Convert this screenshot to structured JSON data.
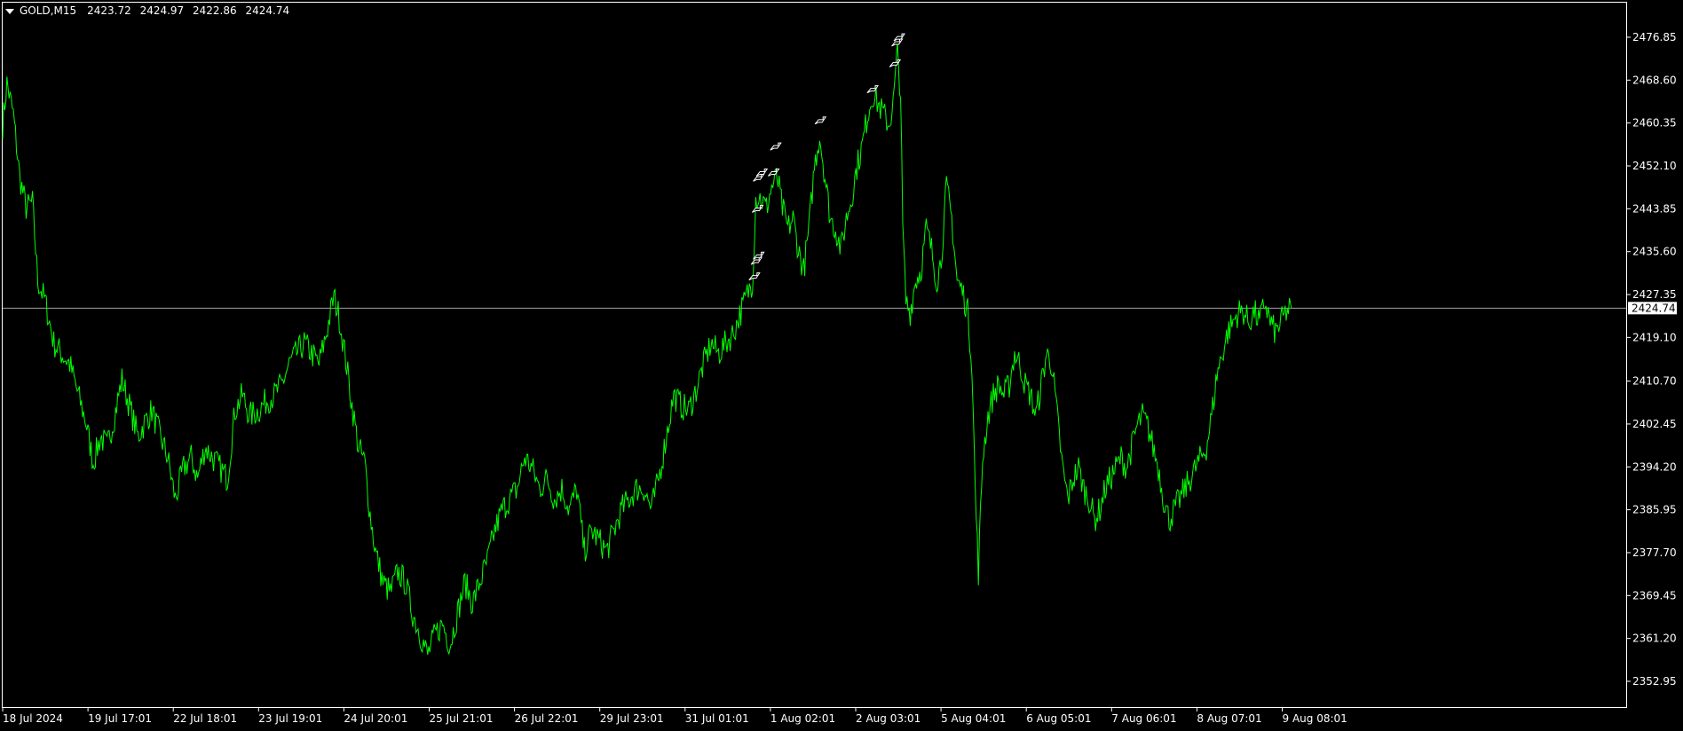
{
  "window": {
    "symbol_label": "GOLD,M15",
    "open": "2423.72",
    "high": "2424.97",
    "low": "2422.86",
    "close": "2424.74"
  },
  "colors": {
    "background": "#000000",
    "line": "#00FF00",
    "grid_frame": "#FFFFFF",
    "bid_line": "#A0A0A0",
    "arrow_marker": "#FFFFFF"
  },
  "chart_data": {
    "type": "line",
    "title": "",
    "xlabel": "",
    "ylabel": "",
    "grid": false,
    "ylim": [
      2348.0,
      2483.5
    ],
    "current_price": 2424.74,
    "current_price_label": "2424.74",
    "y_ticks": [
      "2476.85",
      "2468.60",
      "2460.35",
      "2452.10",
      "2443.85",
      "2435.60",
      "2427.35",
      "2419.10",
      "2410.70",
      "2402.45",
      "2394.20",
      "2385.95",
      "2377.70",
      "2369.45",
      "2361.20",
      "2352.95"
    ],
    "x_ticks": [
      "18 Jul 2024",
      "19 Jul 17:01",
      "22 Jul 18:01",
      "23 Jul 19:01",
      "24 Jul 20:01",
      "25 Jul 21:01",
      "26 Jul 22:01",
      "29 Jul 23:01",
      "31 Jul 01:01",
      "1 Aug 02:01",
      "2 Aug 03:01",
      "5 Aug 04:01",
      "6 Aug 05:01",
      "7 Aug 06:01",
      "8 Aug 07:01",
      "9 Aug 08:01"
    ],
    "series": [
      {
        "points": [
          [
            0,
            2460
          ],
          [
            4,
            2468
          ],
          [
            10,
            2462
          ],
          [
            16,
            2450
          ],
          [
            22,
            2444
          ],
          [
            28,
            2445
          ],
          [
            33,
            2430
          ],
          [
            40,
            2426
          ],
          [
            48,
            2418
          ],
          [
            55,
            2416
          ],
          [
            63,
            2414
          ],
          [
            71,
            2408
          ],
          [
            78,
            2403
          ],
          [
            85,
            2395
          ],
          [
            92,
            2400
          ],
          [
            98,
            2398
          ],
          [
            105,
            2404
          ],
          [
            112,
            2411
          ],
          [
            119,
            2406
          ],
          [
            127,
            2400
          ],
          [
            134,
            2403
          ],
          [
            140,
            2405
          ],
          [
            148,
            2400
          ],
          [
            155,
            2396
          ],
          [
            162,
            2388
          ],
          [
            170,
            2394
          ],
          [
            177,
            2396
          ],
          [
            183,
            2392
          ],
          [
            190,
            2398
          ],
          [
            197,
            2396
          ],
          [
            204,
            2394
          ],
          [
            211,
            2392
          ],
          [
            218,
            2405
          ],
          [
            225,
            2408
          ],
          [
            232,
            2404
          ],
          [
            240,
            2405
          ],
          [
            248,
            2407
          ],
          [
            255,
            2408
          ],
          [
            262,
            2410
          ],
          [
            269,
            2414
          ],
          [
            276,
            2416
          ],
          [
            283,
            2418
          ],
          [
            290,
            2416
          ],
          [
            297,
            2414
          ],
          [
            304,
            2420
          ],
          [
            311,
            2427
          ],
          [
            316,
            2423
          ],
          [
            322,
            2415
          ],
          [
            328,
            2406
          ],
          [
            334,
            2398
          ],
          [
            340,
            2395
          ],
          [
            345,
            2385
          ],
          [
            350,
            2378
          ],
          [
            357,
            2372
          ],
          [
            364,
            2370
          ],
          [
            371,
            2374
          ],
          [
            378,
            2372
          ],
          [
            385,
            2366
          ],
          [
            392,
            2362
          ],
          [
            399,
            2358
          ],
          [
            406,
            2362
          ],
          [
            413,
            2364
          ],
          [
            420,
            2360
          ],
          [
            427,
            2366
          ],
          [
            434,
            2372
          ],
          [
            441,
            2368
          ],
          [
            448,
            2372
          ],
          [
            455,
            2376
          ],
          [
            462,
            2382
          ],
          [
            469,
            2386
          ],
          [
            476,
            2388
          ],
          [
            483,
            2390
          ],
          [
            490,
            2396
          ],
          [
            497,
            2394
          ],
          [
            504,
            2390
          ],
          [
            511,
            2392
          ],
          [
            518,
            2388
          ],
          [
            525,
            2390
          ],
          [
            532,
            2386
          ],
          [
            539,
            2390
          ],
          [
            546,
            2378
          ],
          [
            553,
            2382
          ],
          [
            560,
            2380
          ],
          [
            567,
            2378
          ],
          [
            574,
            2382
          ],
          [
            581,
            2386
          ],
          [
            588,
            2388
          ],
          [
            595,
            2390
          ],
          [
            602,
            2390
          ],
          [
            609,
            2386
          ],
          [
            616,
            2392
          ],
          [
            623,
            2400
          ],
          [
            630,
            2408
          ],
          [
            637,
            2406
          ],
          [
            644,
            2405
          ],
          [
            651,
            2409
          ],
          [
            658,
            2414
          ],
          [
            665,
            2418
          ],
          [
            672,
            2416
          ],
          [
            679,
            2418
          ],
          [
            686,
            2420
          ],
          [
            693,
            2424
          ],
          [
            700,
            2428
          ],
          [
            704,
            2430
          ],
          [
            707,
            2446
          ],
          [
            711,
            2446
          ],
          [
            717,
            2444
          ],
          [
            722,
            2448
          ],
          [
            727,
            2450
          ],
          [
            732,
            2444
          ],
          [
            737,
            2440
          ],
          [
            742,
            2442
          ],
          [
            747,
            2436
          ],
          [
            752,
            2432
          ],
          [
            757,
            2440
          ],
          [
            762,
            2452
          ],
          [
            767,
            2458
          ],
          [
            772,
            2450
          ],
          [
            777,
            2442
          ],
          [
            782,
            2440
          ],
          [
            787,
            2436
          ],
          [
            792,
            2442
          ],
          [
            797,
            2446
          ],
          [
            802,
            2452
          ],
          [
            807,
            2456
          ],
          [
            812,
            2462
          ],
          [
            817,
            2466
          ],
          [
            822,
            2464
          ],
          [
            827,
            2462
          ],
          [
            832,
            2460
          ],
          [
            836,
            2464
          ],
          [
            840,
            2474
          ],
          [
            843,
            2466
          ],
          [
            845,
            2440
          ],
          [
            848,
            2426
          ],
          [
            852,
            2424
          ],
          [
            857,
            2430
          ],
          [
            862,
            2432
          ],
          [
            867,
            2440
          ],
          [
            872,
            2436
          ],
          [
            877,
            2430
          ],
          [
            881,
            2434
          ],
          [
            886,
            2448
          ],
          [
            891,
            2442
          ],
          [
            896,
            2430
          ],
          [
            901,
            2428
          ],
          [
            906,
            2424
          ],
          [
            910,
            2414
          ],
          [
            913,
            2390
          ],
          [
            916,
            2374
          ],
          [
            920,
            2396
          ],
          [
            925,
            2404
          ],
          [
            930,
            2408
          ],
          [
            935,
            2410
          ],
          [
            940,
            2408
          ],
          [
            945,
            2410
          ],
          [
            950,
            2416
          ],
          [
            955,
            2414
          ],
          [
            960,
            2410
          ],
          [
            965,
            2408
          ],
          [
            970,
            2404
          ],
          [
            975,
            2410
          ],
          [
            980,
            2416
          ],
          [
            985,
            2414
          ],
          [
            990,
            2404
          ],
          [
            995,
            2394
          ],
          [
            1000,
            2388
          ],
          [
            1005,
            2392
          ],
          [
            1010,
            2394
          ],
          [
            1015,
            2390
          ],
          [
            1020,
            2388
          ],
          [
            1025,
            2384
          ],
          [
            1030,
            2386
          ],
          [
            1035,
            2390
          ],
          [
            1040,
            2392
          ],
          [
            1045,
            2394
          ],
          [
            1050,
            2396
          ],
          [
            1055,
            2394
          ],
          [
            1060,
            2398
          ],
          [
            1065,
            2402
          ],
          [
            1070,
            2404
          ],
          [
            1075,
            2402
          ],
          [
            1080,
            2398
          ],
          [
            1085,
            2394
          ],
          [
            1090,
            2388
          ],
          [
            1095,
            2384
          ],
          [
            1100,
            2386
          ],
          [
            1105,
            2388
          ],
          [
            1110,
            2390
          ],
          [
            1115,
            2392
          ],
          [
            1120,
            2394
          ],
          [
            1125,
            2396
          ],
          [
            1130,
            2398
          ],
          [
            1135,
            2404
          ],
          [
            1140,
            2412
          ],
          [
            1145,
            2416
          ],
          [
            1150,
            2420
          ],
          [
            1155,
            2422
          ],
          [
            1160,
            2424
          ],
          [
            1165,
            2424
          ],
          [
            1170,
            2422
          ],
          [
            1175,
            2424
          ],
          [
            1180,
            2422
          ],
          [
            1185,
            2426
          ],
          [
            1190,
            2422
          ],
          [
            1195,
            2420
          ],
          [
            1200,
            2422
          ],
          [
            1205,
            2424
          ],
          [
            1210,
            2424.74
          ]
        ]
      }
    ],
    "markers": [
      {
        "x": 704,
        "y": 2431
      },
      {
        "x": 706,
        "y": 2434
      },
      {
        "x": 708,
        "y": 2435
      },
      {
        "x": 707,
        "y": 2444
      },
      {
        "x": 708,
        "y": 2450
      },
      {
        "x": 711,
        "y": 2451
      },
      {
        "x": 722,
        "y": 2451
      },
      {
        "x": 724,
        "y": 2456
      },
      {
        "x": 766,
        "y": 2461
      },
      {
        "x": 815,
        "y": 2467
      },
      {
        "x": 836,
        "y": 2472
      },
      {
        "x": 838,
        "y": 2476
      },
      {
        "x": 840,
        "y": 2477
      }
    ]
  }
}
